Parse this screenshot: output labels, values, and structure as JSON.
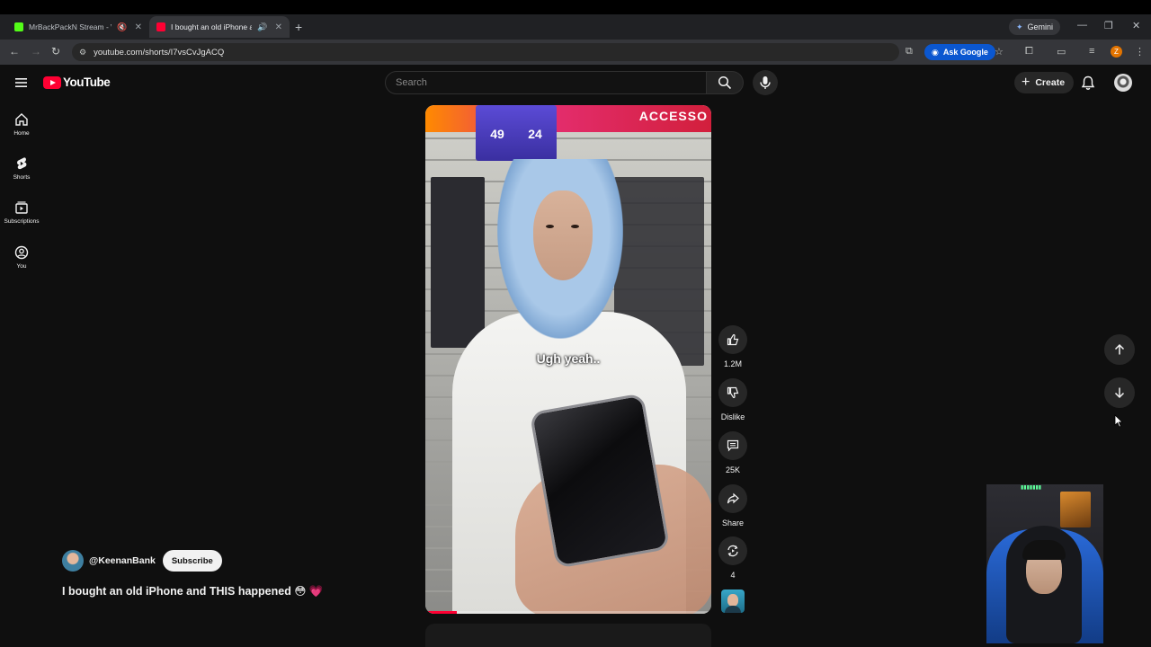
{
  "browser": {
    "tabs": [
      {
        "title": "MrBackPackN Stream - Watch",
        "favicon_color": "#53fc18",
        "status_icon": "muted-speaker-icon",
        "active": false
      },
      {
        "title": "I bought an old iPhone and THIS happened",
        "favicon_color": "#ff0033",
        "status_icon": "speaker-icon",
        "active": true
      }
    ],
    "gemini_label": "Gemini",
    "url": "youtube.com/shorts/I7vsCvJgACQ",
    "ask_google_label": "Ask Google",
    "profile_initial": "Z"
  },
  "youtube": {
    "logo_text": "YouTube",
    "search_placeholder": "Search",
    "create_label": "Create",
    "sidebar": [
      {
        "label": "Home",
        "icon": "home-icon"
      },
      {
        "label": "Shorts",
        "icon": "shorts-icon"
      },
      {
        "label": "Subscriptions",
        "icon": "subscriptions-icon"
      },
      {
        "label": "You",
        "icon": "you-icon"
      }
    ],
    "short": {
      "caption": "Ugh yeah..",
      "banner_text": "ACCESSO",
      "posters": [
        "49",
        "24"
      ],
      "progress_fraction": 0.11
    },
    "actions": {
      "likes": "1.2M",
      "dislike_label": "Dislike",
      "comments": "25K",
      "share_label": "Share",
      "remix_count": "4"
    },
    "channel": {
      "handle": "@KeenanBank",
      "subscribe_label": "Subscribe"
    },
    "video_title": "I bought an old iPhone and THIS happened 😳 💗"
  },
  "colors": {
    "accent": "#ff0033",
    "background": "#0f0f0f"
  }
}
